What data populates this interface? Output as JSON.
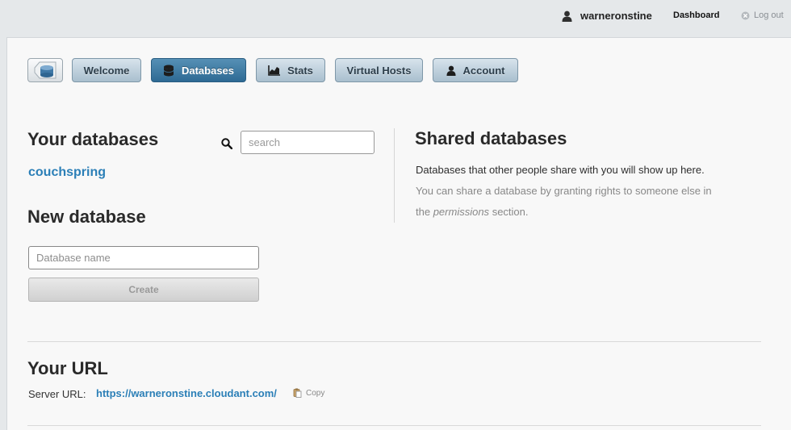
{
  "header": {
    "username": "warneronstine",
    "dashboard_label": "Dashboard",
    "logout_label": "Log out"
  },
  "nav": {
    "tabs": [
      {
        "label": "Welcome",
        "icon": "none",
        "active": false
      },
      {
        "label": "Databases",
        "icon": "database-icon",
        "active": true
      },
      {
        "label": "Stats",
        "icon": "chart-icon",
        "active": false
      },
      {
        "label": "Virtual Hosts",
        "icon": "none",
        "active": false
      },
      {
        "label": "Account",
        "icon": "user-icon",
        "active": false
      }
    ]
  },
  "your_databases": {
    "title": "Your databases",
    "search_placeholder": "search",
    "databases": [
      "couchspring"
    ]
  },
  "new_database": {
    "title": "New database",
    "name_placeholder": "Database name",
    "create_label": "Create"
  },
  "shared_databases": {
    "title": "Shared databases",
    "line1": "Databases that other people share with you will show up here.",
    "line2_prefix": "You can share a database by granting rights to someone else in",
    "line3_the": "the",
    "line3_link": "permissions",
    "line3_suffix": "section."
  },
  "your_url": {
    "title": "Your URL",
    "server_label": "Server URL:",
    "server_url": "https://warneronstine.cloudant.com/",
    "copy_label": "Copy"
  },
  "colors": {
    "accent": "#2b7fb7",
    "active_tab": "#3a77a0",
    "tab": "#bfd0dc",
    "background": "#e5e8ea",
    "panel": "#f8f8f8"
  }
}
